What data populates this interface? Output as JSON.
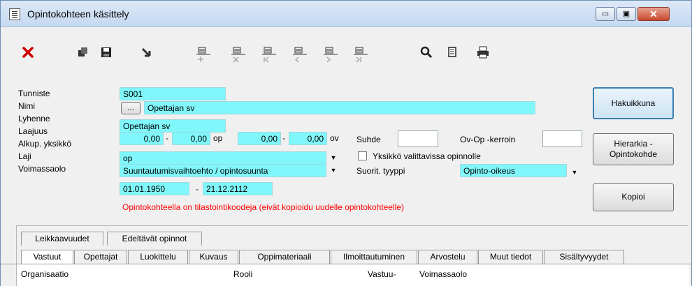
{
  "window": {
    "title": "Opintokohteen käsittely",
    "controls": {
      "minimize": "▭",
      "maximize": "▣",
      "close": "✕"
    }
  },
  "toolbar": {
    "icons": [
      "delete-icon",
      "copy-icon",
      "save-icon",
      "export-icon",
      "record-add-icon",
      "record-delete-icon",
      "record-first-icon",
      "record-previous-icon",
      "record-next-icon",
      "record-last-icon",
      "search-icon",
      "document-icon",
      "print-icon"
    ]
  },
  "form": {
    "labels": {
      "tunniste": "Tunniste",
      "nimi": "Nimi",
      "lyhenne": "Lyhenne",
      "laajuus": "Laajuus",
      "alkup": "Alkup. yksikkö",
      "laji": "Laji",
      "voimassaolo": "Voimassaolo",
      "suhde": "Suhde",
      "ovop": "Ov-Op -kerroin",
      "yksikko_check": "Yksikkö valittavissa opinnolle",
      "suorit": "Suorit. tyyppi"
    },
    "values": {
      "tunniste": "S001",
      "nimi_button": "...",
      "nimi": "Opettajan sv",
      "lyhenne": "Opettajan sv",
      "laajuus_op_min": "0,00",
      "laajuus_op_max": "0,00",
      "unit_op": "op",
      "laajuus_ov_min": "0,00",
      "laajuus_ov_max": "0,00",
      "unit_ov": "ov",
      "dash": "-",
      "suhde": "",
      "ovop": "",
      "alkup": "op",
      "laji": "Suuntautumisvaihtoehto / opintosuunta",
      "suorit": "Opinto-oikeus",
      "voimassa_alku": "01.01.1950",
      "voimassa_loppu": "21.12.2112"
    },
    "warning": "Opintokohteella on tilastointikoodeja (eivät kopioidu uudelle opintokohteelle)",
    "arrow": "▼"
  },
  "buttons": {
    "hakuikkuna": "Hakuikkuna",
    "hierarkia_line1": "Hierarkia -",
    "hierarkia_line2": "Opintokohde",
    "kopioi": "Kopioi"
  },
  "tabs": {
    "row1": [
      "Leikkaavuudet",
      "Edeltävät opinnot"
    ],
    "row2": [
      "Vastuut",
      "Opettajat",
      "Luokittelu",
      "Kuvaus",
      "Oppimateriaali",
      "Ilmoittautuminen",
      "Arvostelu",
      "Muut tiedot",
      "Sisältyvyydet"
    ]
  },
  "grid": {
    "columns": [
      "Organisaatio",
      "Rooli",
      "Vastuu-",
      "Voimassaolo"
    ]
  }
}
